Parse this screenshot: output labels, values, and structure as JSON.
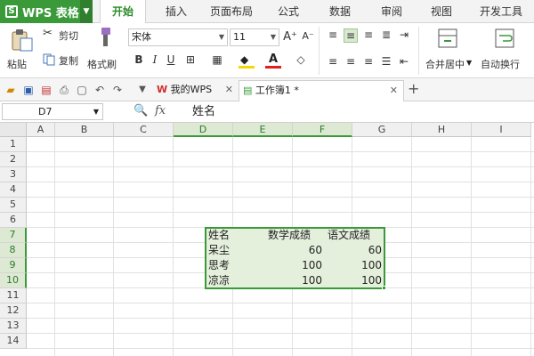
{
  "app": {
    "logo": "WPS 表格"
  },
  "ribbon_tabs": [
    "开始",
    "插入",
    "页面布局",
    "公式",
    "数据",
    "审阅",
    "视图",
    "开发工具"
  ],
  "clipboard": {
    "paste": "粘贴",
    "cut": "剪切",
    "copy": "复制",
    "format_painter": "格式刷"
  },
  "font": {
    "name": "宋体",
    "size": "11"
  },
  "merge": {
    "label": "合并居中"
  },
  "wrap": {
    "label": "自动换行"
  },
  "doc_tabs": [
    {
      "label": "我的WPS"
    },
    {
      "label": "工作簿1 *"
    }
  ],
  "formula_bar": {
    "cell_ref": "D7",
    "fx": "fx",
    "value": "姓名"
  },
  "grid": {
    "columns": [
      "A",
      "B",
      "C",
      "D",
      "E",
      "F",
      "G",
      "H",
      "I"
    ],
    "rows": [
      "1",
      "2",
      "3",
      "4",
      "5",
      "6",
      "7",
      "8",
      "9",
      "10",
      "11",
      "12",
      "13",
      "14"
    ],
    "selected_column_labels": [
      "D",
      "E",
      "F"
    ],
    "selected_row_labels": [
      "7",
      "8",
      "9",
      "10"
    ]
  },
  "table": {
    "headers": [
      "姓名",
      "数学成绩",
      "语文成绩"
    ],
    "rows": [
      {
        "name": "呆尘",
        "math": "60",
        "chinese": "60"
      },
      {
        "name": "思考",
        "math": "100",
        "chinese": "100"
      },
      {
        "name": "凉凉",
        "math": "100",
        "chinese": "100"
      }
    ]
  },
  "colors": {
    "accent": "#3a9a3a",
    "selection_fill": "#e4efdc",
    "header_selected": "#dde9d2"
  }
}
